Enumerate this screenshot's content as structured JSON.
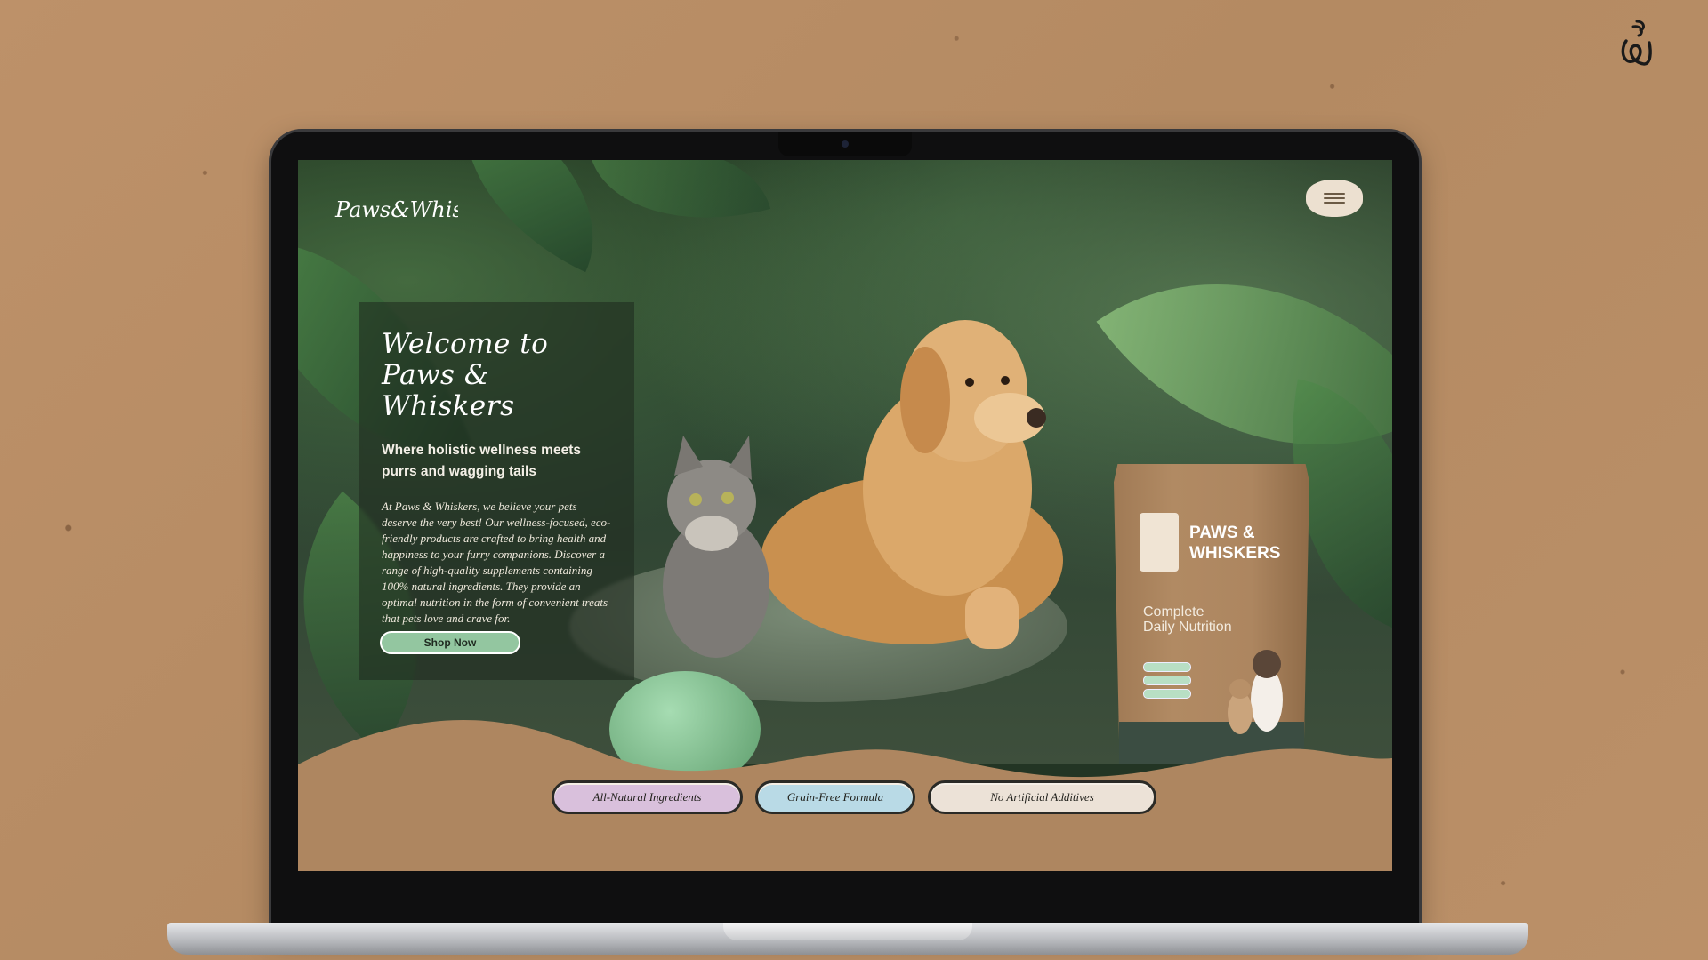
{
  "site": {
    "logo_text": "Paws&Whiskers",
    "menu_icon": "hamburger-menu-icon"
  },
  "hero": {
    "title_line1": "Welcome to",
    "title_line2": "Paws & Whiskers",
    "subtitle": "Where holistic wellness meets purrs and wagging tails",
    "body": "At Paws & Whiskers, we believe your pets deserve the very best! Our wellness-focused, eco-friendly products are crafted to bring health and happiness to your furry companions. Discover a range of high-quality supplements containing 100% natural ingredients. They provide an optimal nutrition in the form of convenient treats that pets love and crave for.",
    "cta_label": "Shop Now"
  },
  "product": {
    "brand_line1": "PAWS &",
    "brand_line2": "WHISKERS",
    "tagline_line1": "Complete",
    "tagline_line2": "Daily Nutrition"
  },
  "features": [
    {
      "label": "All-Natural Ingredients",
      "color": "#d9c0dc"
    },
    {
      "label": "Grain-Free Formula",
      "color": "#b9dae6"
    },
    {
      "label": "No Artificial Additives",
      "color": "#ece2d7"
    }
  ],
  "colors": {
    "background": "#b98f66",
    "ground": "#ae8660",
    "cta": "#93c6a0",
    "bag_bottom": "#3b4d42"
  }
}
